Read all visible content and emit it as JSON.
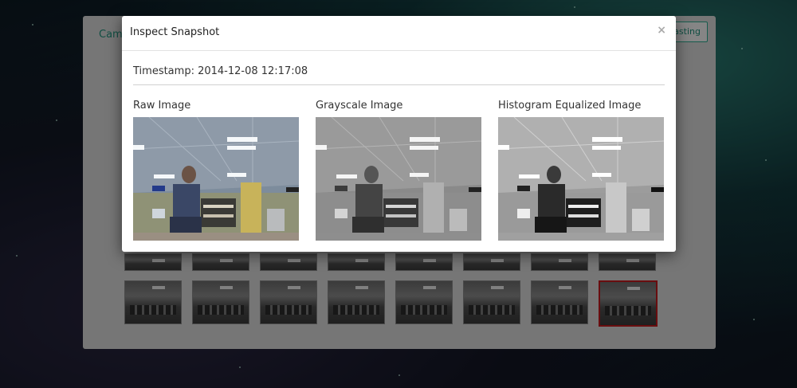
{
  "background": {
    "panel_title": "Came",
    "cast_button_label": "Casting",
    "thumbnail_rows": [
      {
        "count": 8,
        "short": true
      },
      {
        "count": 8,
        "short": false,
        "selected_index": 7
      }
    ]
  },
  "modal": {
    "title": "Inspect Snapshot",
    "close_label": "×",
    "timestamp_label": "Timestamp: 2014-12-08 12:17:08",
    "images": [
      {
        "label": "Raw Image",
        "mode": "color"
      },
      {
        "label": "Grayscale Image",
        "mode": "gray"
      },
      {
        "label": "Histogram Equalized Image",
        "mode": "equalized"
      }
    ]
  },
  "colors": {
    "accent": "#1f8f7a",
    "selected_border": "#c0181c"
  }
}
